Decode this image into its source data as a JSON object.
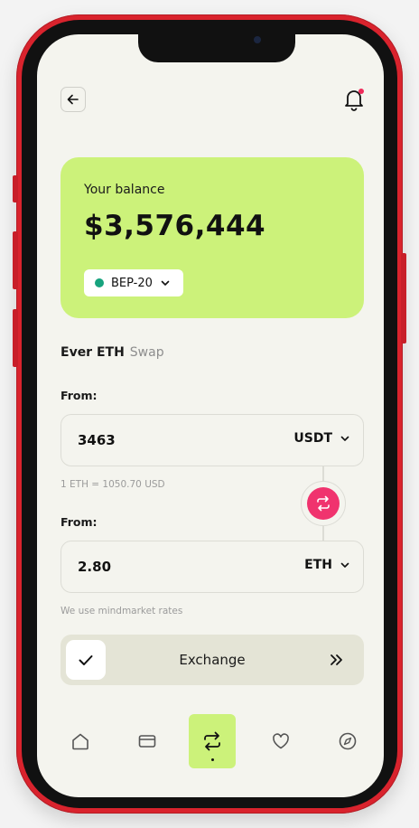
{
  "header": {
    "back_icon": "arrow-left-icon",
    "notification_icon": "bell-icon"
  },
  "balance": {
    "label": "Your balance",
    "amount": "$3,576,444",
    "network": "BEP-20",
    "network_color": "#17a37e",
    "card_color": "#ccf27a"
  },
  "section": {
    "title": "Ever ETH",
    "subtitle": "Swap"
  },
  "from_field": {
    "label": "From:",
    "value": "3463",
    "currency": "USDT"
  },
  "rate": {
    "text": "1 ETH = 1050.70 USD"
  },
  "to_field": {
    "label": "From:",
    "value": "2.80",
    "currency": "ETH"
  },
  "note": {
    "text": "We use mindmarket rates"
  },
  "exchange": {
    "label": "Exchange"
  },
  "tabs": [
    {
      "icon": "home-icon",
      "active": false
    },
    {
      "icon": "card-icon",
      "active": false
    },
    {
      "icon": "swap-icon",
      "active": true
    },
    {
      "icon": "heart-icon",
      "active": false
    },
    {
      "icon": "compass-icon",
      "active": false
    }
  ],
  "colors": {
    "accent_green": "#ccf27a",
    "swap_pink": "#f0336e",
    "phone_red": "#d9232d"
  }
}
